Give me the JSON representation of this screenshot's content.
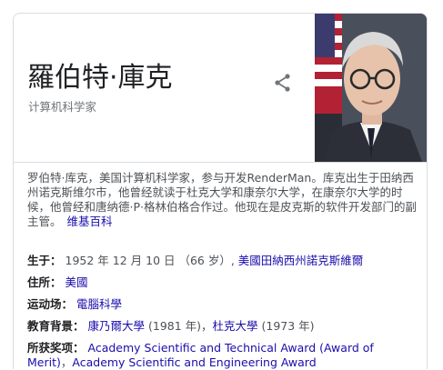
{
  "title": "羅伯特·庫克",
  "subtitle": "计算机科学家",
  "description": {
    "text": "罗伯特·库克，美国计算机科学家，参与开发RenderMan。库克出生于田纳西州诺克斯维尔市，他曾经就读于杜克大学和康奈尔大学，在康奈尔大学的时候，他曾经和唐纳德·P·格林伯格合作过。他现在是皮克斯的软件开发部门的副主管。",
    "source_link": "维基百科"
  },
  "facts": {
    "born": {
      "label": "生于：",
      "date": "1952 年 12 月 10 日 （66 岁）, ",
      "place": "美國田納西州諾克斯維爾"
    },
    "residence": {
      "label": "住所：",
      "value": "美國"
    },
    "field": {
      "label": "运动场：",
      "value": "電腦科學"
    },
    "education": {
      "label": "教育背景：",
      "school1": "康乃爾大學",
      "year1": " (1981 年)，",
      "school2": "杜克大學",
      "year2": " (1973 年)"
    },
    "awards": {
      "label": "所获奖项：",
      "award1": "Academy Scientific and Technical Award (Award of Merit)",
      "sep": "，",
      "award2": "Academy Scientific and Engineering Award"
    }
  },
  "icons": {
    "share": "share-icon"
  },
  "colors": {
    "link": "#1a0dab",
    "muted": "#70757a",
    "border": "#dadce0"
  }
}
